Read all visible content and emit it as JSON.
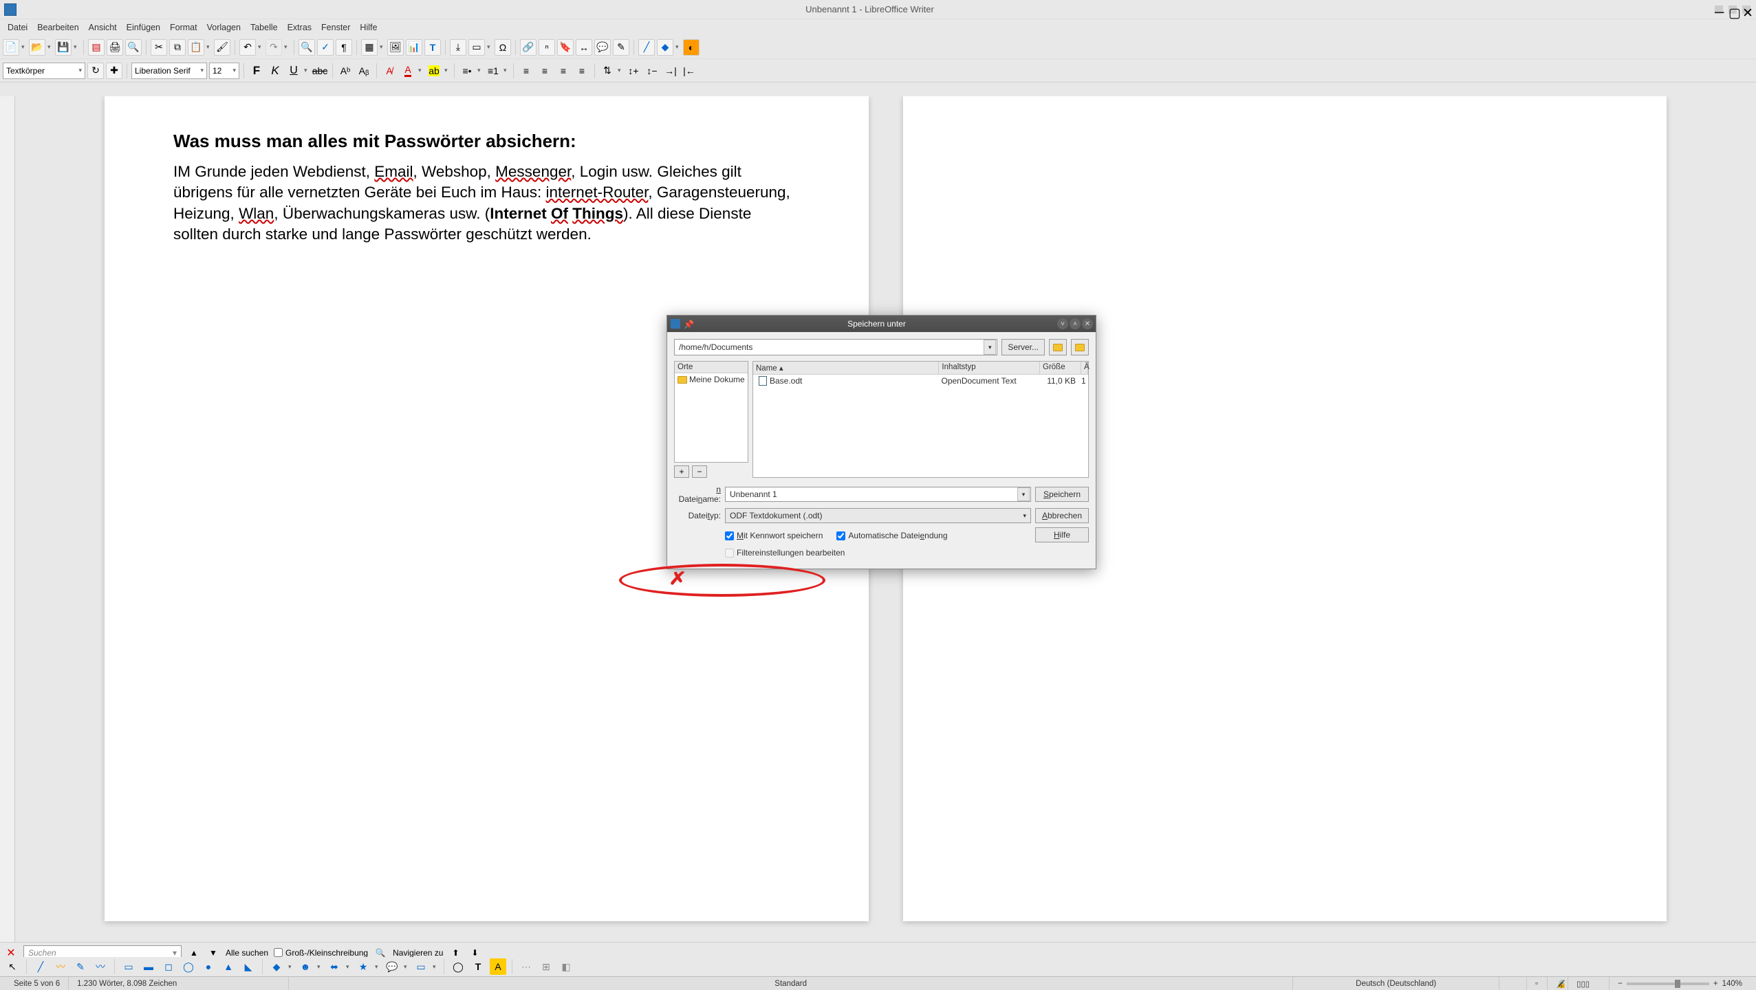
{
  "window": {
    "title": "Unbenannt 1 - LibreOffice Writer"
  },
  "menu": {
    "items": [
      "Datei",
      "Bearbeiten",
      "Ansicht",
      "Einfügen",
      "Format",
      "Vorlagen",
      "Tabelle",
      "Extras",
      "Fenster",
      "Hilfe"
    ]
  },
  "formatbar": {
    "style": "Textkörper",
    "font": "Liberation Serif",
    "size": "12"
  },
  "document": {
    "heading": "Was muss man alles mit Passwörter absichern:",
    "para": "IM Grunde jeden Webdienst, Email, Webshop, Messenger, Login usw. Gleiches gilt übrigens für alle vernetzten Geräte bei Euch im Haus: internet-Router, Garagensteuerung, Heizung, Wlan, Überwachungskameras usw. (Internet Of Things). All diese Dienste sollten durch starke und lange Passwörter geschützt werden."
  },
  "dialog": {
    "title": "Speichern unter",
    "path": "/home/h/Documents",
    "server_btn": "Server...",
    "places_hdr": "Orte",
    "places_item": "Meine Dokume",
    "col_name": "Name",
    "col_type": "Inhaltstyp",
    "col_size": "Größe",
    "file_name": "Base.odt",
    "file_type": "OpenDocument Text",
    "file_size": "11,0 KB",
    "filename_label": "Dateiname:",
    "filename_value": "Unbenannt 1",
    "filetype_label": "Dateityp:",
    "filetype_value": "ODF Textdokument (.odt)",
    "save_btn": "Speichern",
    "cancel_btn": "Abbrechen",
    "help_btn": "Hilfe",
    "chk_password": "Mit Kennwort speichern",
    "chk_autoext": "Automatische Dateiendung",
    "chk_filter": "Filtereinstellungen bearbeiten"
  },
  "findbar": {
    "placeholder": "Suchen",
    "all": "Alle suchen",
    "case": "Groß-/Kleinschreibung",
    "nav": "Navigieren zu"
  },
  "status": {
    "page": "Seite 5 von 6",
    "words": "1.230 Wörter, 8.098 Zeichen",
    "style": "Standard",
    "lang": "Deutsch (Deutschland)",
    "zoom": "140%"
  }
}
